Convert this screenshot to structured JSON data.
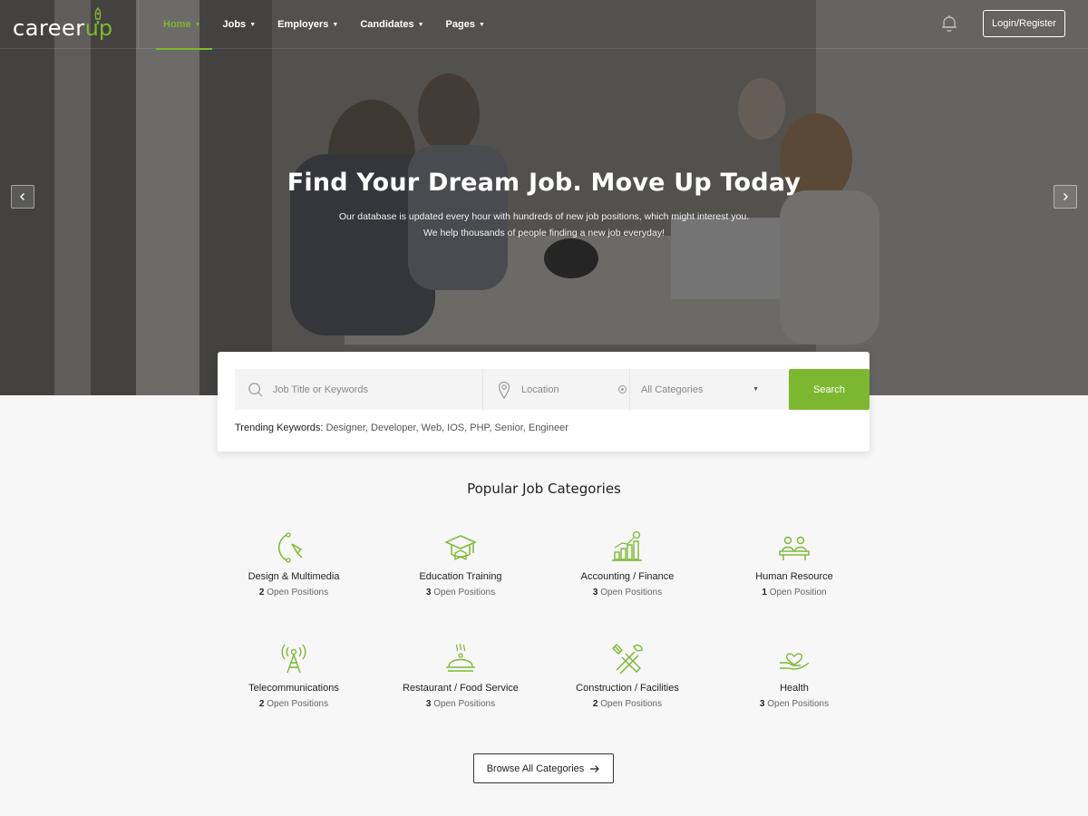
{
  "brand": {
    "name": "career",
    "accent": "up",
    "accent_color": "#7cb82f"
  },
  "nav": {
    "items": [
      {
        "label": "Home",
        "active": true
      },
      {
        "label": "Jobs",
        "active": false
      },
      {
        "label": "Employers",
        "active": false
      },
      {
        "label": "Candidates",
        "active": false
      },
      {
        "label": "Pages",
        "active": false
      }
    ],
    "notification_icon": "bell-icon",
    "login_label": "Login/Register"
  },
  "hero": {
    "title": "Find Your Dream Job. Move Up Today",
    "subtitle_line1": "Our database is updated every hour with hundreds of new job positions, which might interest you.",
    "subtitle_line2": "We help thousands of people finding a new job everyday!"
  },
  "search": {
    "keyword_placeholder": "Job Title or Keywords",
    "location_placeholder": "Location",
    "category_selected": "All Categories",
    "button_label": "Search",
    "trending_label": "Trending Keywords:",
    "trending_keywords": "Designer, Developer, Web, IOS, PHP, Senior, Engineer"
  },
  "categories": {
    "title": "Popular Job Categories",
    "items": [
      {
        "name": "Design & Multimedia",
        "count": "2",
        "unit": "Open Positions",
        "icon": "design-pen-icon"
      },
      {
        "name": "Education Training",
        "count": "3",
        "unit": "Open Positions",
        "icon": "graduation-cap-icon"
      },
      {
        "name": "Accounting / Finance",
        "count": "3",
        "unit": "Open Positions",
        "icon": "finance-chart-icon"
      },
      {
        "name": "Human Resource",
        "count": "1",
        "unit": "Open Position",
        "icon": "human-resource-icon"
      },
      {
        "name": "Telecommunications",
        "count": "2",
        "unit": "Open Positions",
        "icon": "antenna-tower-icon"
      },
      {
        "name": "Restaurant / Food Service",
        "count": "3",
        "unit": "Open Positions",
        "icon": "cloche-icon"
      },
      {
        "name": "Construction / Facilities",
        "count": "2",
        "unit": "Open Positions",
        "icon": "tools-icon"
      },
      {
        "name": "Health",
        "count": "3",
        "unit": "Open Positions",
        "icon": "health-hand-icon"
      }
    ],
    "browse_label": "Browse All Categories"
  }
}
